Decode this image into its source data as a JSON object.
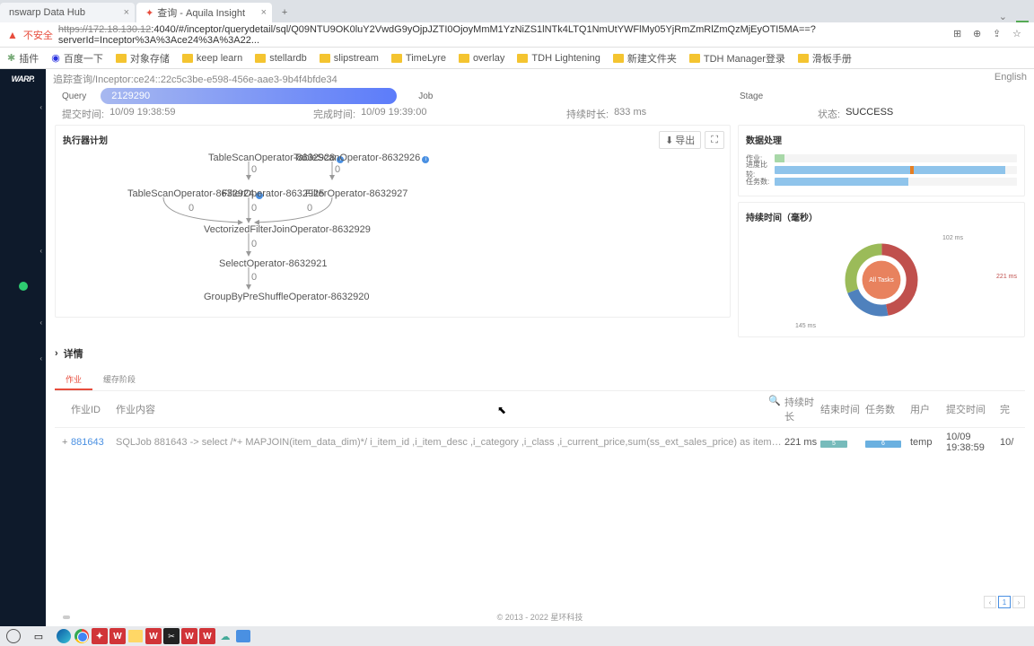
{
  "tabs": [
    {
      "title": "nswarp Data Hub"
    },
    {
      "title": "查询 - Aquila Insight"
    }
  ],
  "addr": {
    "insecure": "不安全",
    "host": "https://172.18.130.12",
    "path": ":4040/#/inceptor/querydetail/sql/Q09NTU9OK0luY2VwdG9yOjpJZTI0OjoyMmM1YzNiZS1lNTk4LTQ1NmUtYWFlMy05YjRmZmRlZmQzMjEyOTI5MA==?serverId=Inceptor%3A%3Ace24%3A%3A22..."
  },
  "bookmarks": [
    "插件",
    "百度一下",
    "对象存储",
    "keep learn",
    "stellardb",
    "slipstream",
    "TimeLyre",
    "overlay",
    "TDH Lightening",
    "新建文件夹",
    "TDH Manager登录",
    "滑板手册"
  ],
  "logo": "WARP.",
  "breadcrumb": "追踪查询/Inceptor:ce24::22c5c3be-e598-456e-aae3-9b4f4bfde34",
  "lang": "English",
  "stages": {
    "query_lbl": "Query",
    "query_val": "2129290",
    "job_lbl": "Job",
    "stage_lbl": "Stage"
  },
  "times": {
    "submit_lbl": "提交时间:",
    "submit_val": "10/09 19:38:59",
    "end_lbl": "完成时间:",
    "end_val": "10/09 19:39:00",
    "dur_lbl": "持续时长:",
    "dur_val": "833 ms",
    "status_lbl": "状态:",
    "status_val": "SUCCESS"
  },
  "plan_title": "执行器计划",
  "export_btn": "导出",
  "data_title": "数据处理",
  "bars": {
    "job": "作业:",
    "progress": "进度比较:",
    "tasks": "任务数:"
  },
  "pie_title": "持续时间（毫秒）",
  "pie_center": "All Tasks",
  "pie_labels": {
    "a": "102 ms",
    "b": "221 ms",
    "c": "145 ms"
  },
  "details": "详情",
  "dtabs": [
    "作业",
    "缓存阶段"
  ],
  "thead": {
    "id": "作业ID",
    "content": "作业内容",
    "dur": "持续时长",
    "end": "结束时间",
    "tasks": "任务数",
    "user": "用户",
    "submit": "提交时间",
    "done": "完"
  },
  "row": {
    "id": "881643",
    "content": "SQLJob 881643 -> select /*+ MAPJOIN(item_data_dim)*/ i_item_id ,i_item_desc ,i_category ,i_class ,i_current_price,sum(ss_ext_sales_price) as itemrevenue ,sum(ss_ext_sales_price)*100/sum(sum(ss_ext_sales_price)) over (partition by...",
    "dur": "221 ms",
    "b1": "5",
    "b2": "6",
    "user": "temp",
    "submit": "10/09 19:38:59",
    "done": "10/"
  },
  "nodes": {
    "n1": "TableScanOperator-8632928",
    "n2": "TableScanOperator-8632926",
    "n3": "TableScanOperator-8632924",
    "n4": "FilterOperator-8632925",
    "n5": "FilterOperator-8632927",
    "n6": "VectorizedFilterJoinOperator-8632929",
    "n7": "SelectOperator-8632921",
    "n8": "GroupByPreShuffleOperator-8632920"
  },
  "footer": "© 2013 - 2022 星环科技",
  "chart_data": {
    "type": "pie",
    "title": "持续时间（毫秒）",
    "series": [
      {
        "name": "All Tasks",
        "values": [
          102,
          221,
          145
        ]
      }
    ],
    "labels": [
      "102 ms",
      "221 ms",
      "145 ms"
    ]
  }
}
